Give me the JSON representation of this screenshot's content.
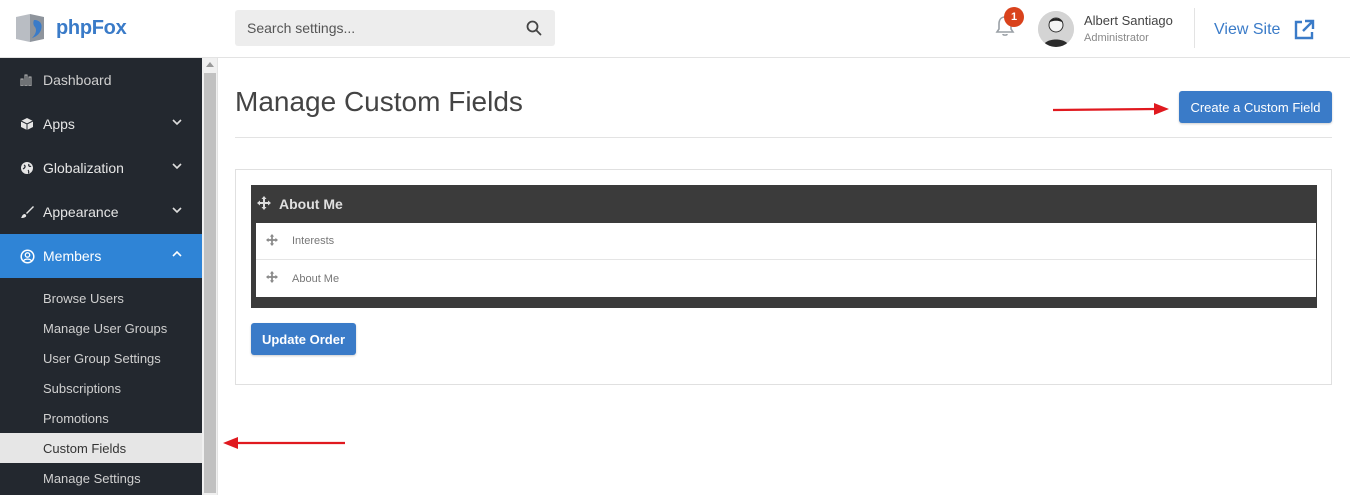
{
  "header": {
    "logo_text": "phpFox",
    "search_placeholder": "Search settings...",
    "notification_count": "1",
    "user_name": "Albert Santiago",
    "user_role": "Administrator",
    "view_site_label": "View Site"
  },
  "sidebar": {
    "items": [
      {
        "label": "Dashboard",
        "icon": "bar-chart-icon"
      },
      {
        "label": "Apps",
        "icon": "cube-icon"
      },
      {
        "label": "Globalization",
        "icon": "globe-icon"
      },
      {
        "label": "Appearance",
        "icon": "brush-icon"
      },
      {
        "label": "Members",
        "icon": "user-circle-icon"
      }
    ],
    "members_subitems": [
      "Browse Users",
      "Manage User Groups",
      "User Group Settings",
      "Subscriptions",
      "Promotions",
      "Custom Fields",
      "Manage Settings"
    ]
  },
  "main": {
    "title": "Manage Custom Fields",
    "create_button": "Create a Custom Field",
    "group_title": "About Me",
    "fields": [
      "Interests",
      "About Me"
    ],
    "update_button": "Update Order"
  },
  "colors": {
    "accent": "#3a7bc8",
    "sidebar_bg": "#23282f",
    "active_nav": "#2f84d6",
    "badge": "#d9421c",
    "annotation_arrow": "#e0191f"
  }
}
